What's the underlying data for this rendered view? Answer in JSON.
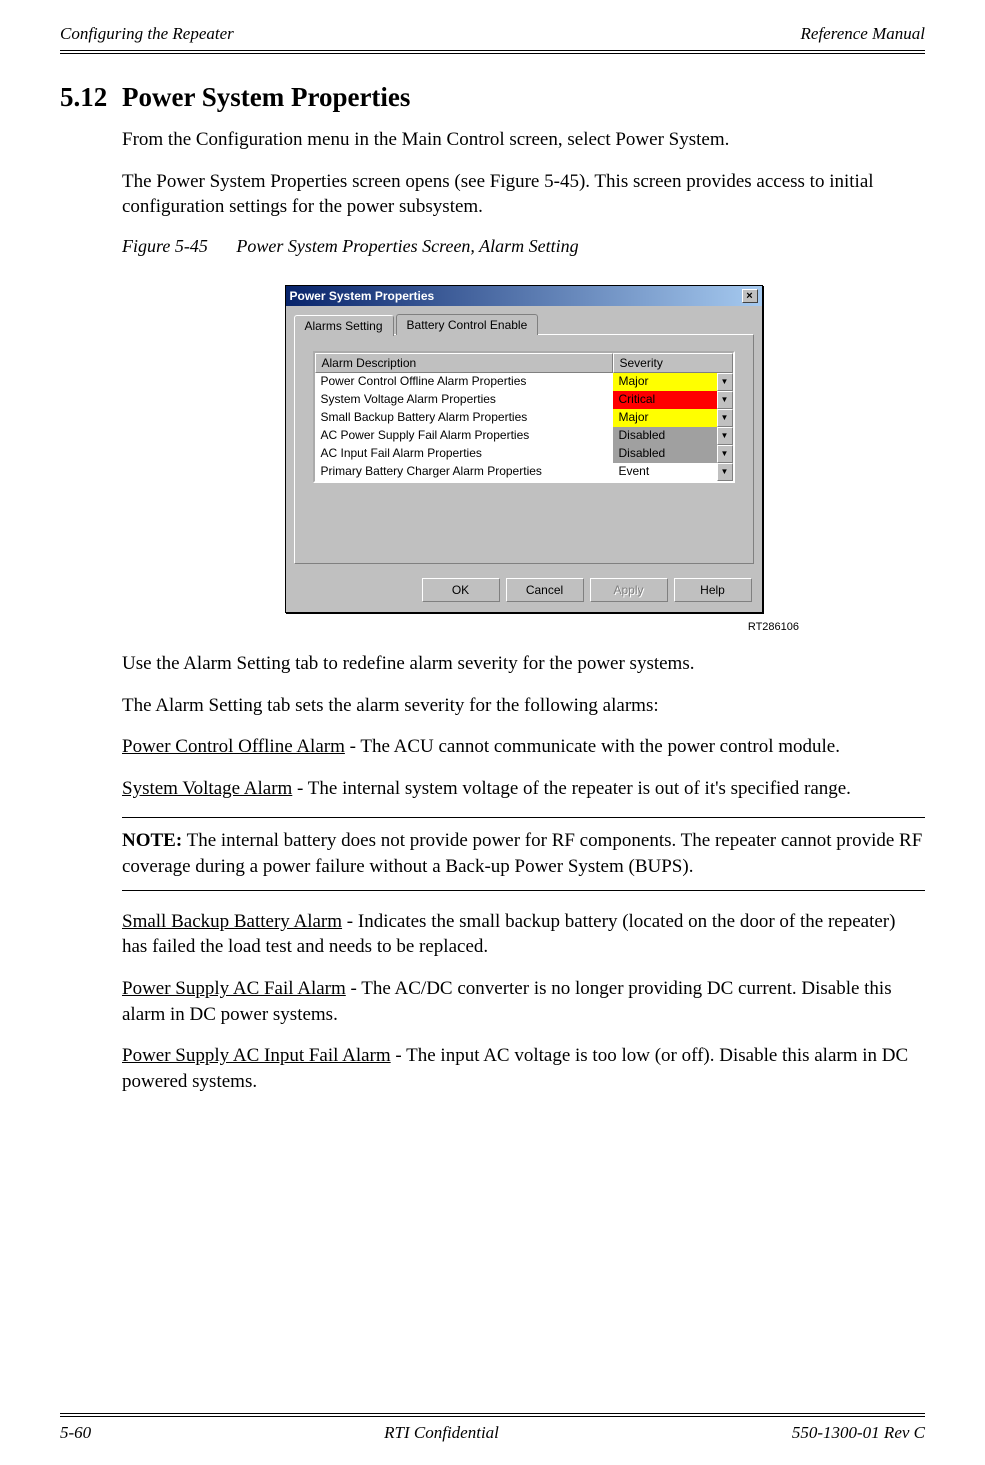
{
  "header": {
    "left": "Configuring the Repeater",
    "right": "Reference Manual"
  },
  "section": {
    "number": "5.12",
    "title": "Power System Properties"
  },
  "paragraphs": {
    "p1": "From the Configuration menu in the Main Control screen, select Power System.",
    "p2": "The Power System Properties screen opens (see Figure 5-45). This screen provides access to initial configuration settings for the power subsystem."
  },
  "figure": {
    "num": "Figure 5-45",
    "caption": "Power System Properties Screen, Alarm Setting",
    "id": "RT286106"
  },
  "dialog": {
    "title": "Power System Properties",
    "tabs": {
      "active": "Alarms Setting",
      "other": "Battery Control Enable"
    },
    "columns": {
      "desc": "Alarm Description",
      "sev": "Severity"
    },
    "rows": [
      {
        "desc": "Power Control Offline Alarm Properties",
        "sev": "Major",
        "cls": "sev-major"
      },
      {
        "desc": "System Voltage Alarm Properties",
        "sev": "Critical",
        "cls": "sev-critical"
      },
      {
        "desc": "Small Backup Battery Alarm Properties",
        "sev": "Major",
        "cls": "sev-major"
      },
      {
        "desc": "AC Power Supply Fail Alarm Properties",
        "sev": "Disabled",
        "cls": "sev-disabled"
      },
      {
        "desc": "AC Input Fail Alarm Properties",
        "sev": "Disabled",
        "cls": "sev-disabled"
      },
      {
        "desc": "Primary Battery Charger Alarm Properties",
        "sev": "Event",
        "cls": "sev-event"
      }
    ],
    "buttons": {
      "ok": "OK",
      "cancel": "Cancel",
      "apply": "Apply",
      "help": "Help"
    }
  },
  "body": {
    "use_tab": "Use the Alarm Setting tab to redefine alarm severity for the power systems.",
    "sets": "The Alarm Setting tab sets the alarm severity for the following alarms:",
    "a1_name": "Power Control Offline Alarm",
    "a1_text": " - The ACU cannot communicate with the power control module.",
    "a2_name": "System Voltage Alarm",
    "a2_text": " - The internal system voltage of the repeater is out of it's specified range.",
    "note_label": "NOTE:",
    "note_text": "  The internal battery does not provide power for RF components. The repeater cannot provide RF coverage during a power failure without a Back-up Power System (BUPS).",
    "a3_name": "Small Backup Battery Alarm",
    "a3_text": " - Indicates the small backup battery (located on the door of the repeater) has failed the load test and needs to be replaced.",
    "a4_name": "Power Supply AC Fail Alarm",
    "a4_text": " - The AC/DC converter is no longer providing DC current. Disable this alarm in DC power systems.",
    "a5_name": "Power Supply AC Input Fail Alarm",
    "a5_text": " - The input AC voltage is too low (or off). Disable this alarm in DC powered systems."
  },
  "footer": {
    "left": "5-60",
    "center": "RTI Confidential",
    "right": "550-1300-01 Rev C"
  }
}
